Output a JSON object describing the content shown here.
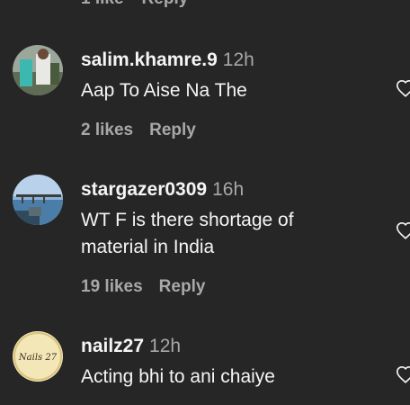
{
  "partial_top": {
    "likes": "1 like",
    "reply": "Reply"
  },
  "comments": [
    {
      "username": "salim.khamre.9",
      "time": "12h",
      "text": "Aap To Aise Na The",
      "likes": "2 likes",
      "reply": "Reply"
    },
    {
      "username": "stargazer0309",
      "time": "16h",
      "text": "WT F is there shortage of material in India",
      "likes": "19 likes",
      "reply": "Reply"
    },
    {
      "username": "nailz27",
      "time": "12h",
      "text": "Acting bhi to ani chaiye",
      "avatar_text": "Nails 27"
    }
  ],
  "icons": {
    "heart": "heart-outline-icon"
  },
  "colors": {
    "background": "#262626",
    "primary_text": "#f5f5f5",
    "secondary_text": "#a8a8a8"
  }
}
